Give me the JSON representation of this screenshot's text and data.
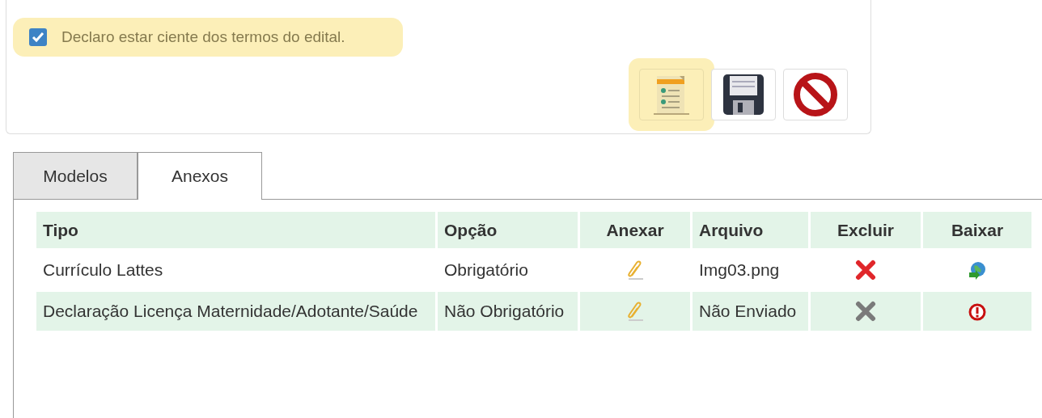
{
  "notice": {
    "text": "Declaro estar ciente dos termos do edital.",
    "checked": true
  },
  "toolbar": [
    {
      "kind": "document",
      "highlighted": true
    },
    {
      "kind": "save",
      "highlighted": false
    },
    {
      "kind": "cancel",
      "highlighted": false
    }
  ],
  "tabs": [
    {
      "label": "Modelos",
      "selected": false
    },
    {
      "label": "Anexos",
      "selected": true
    }
  ],
  "table": {
    "columns": [
      "Tipo",
      "Opção",
      "Anexar",
      "Arquivo",
      "Excluir",
      "Baixar"
    ],
    "rows": [
      {
        "tipo": "Currículo Lattes",
        "opcao": "Obrigatório",
        "arquivo": "Img03.png",
        "excluir_enabled": true,
        "file_available": true
      },
      {
        "tipo": "Declaração Licença Maternidade/Adotante/Saúde",
        "opcao": "Não Obrigatório",
        "arquivo": "Não Enviado",
        "excluir_enabled": false,
        "file_available": false
      }
    ]
  }
}
